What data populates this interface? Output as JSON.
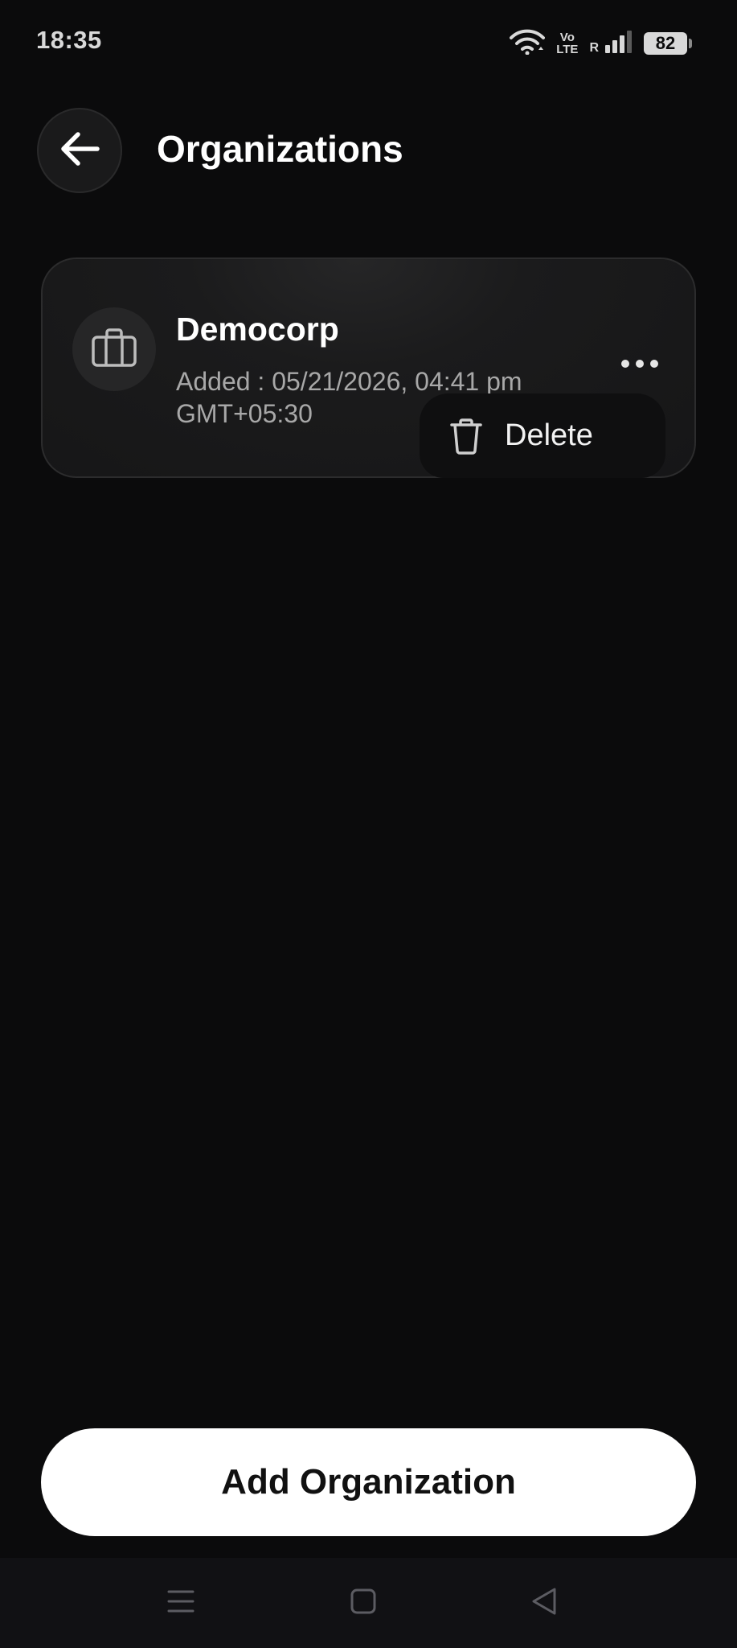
{
  "status_bar": {
    "time": "18:35",
    "volte_top": "Vo",
    "volte_bottom": "LTE",
    "roaming": "R",
    "battery": "82",
    "icons": [
      "wifi-icon",
      "volte-icon",
      "signal-icon",
      "battery-icon"
    ]
  },
  "header": {
    "title": "Organizations",
    "back_icon": "arrow-left-icon"
  },
  "organizations": [
    {
      "name": "Democorp",
      "added_line1": "Added : 05/21/2026, 04:41 pm",
      "added_line2": "GMT+05:30",
      "icon": "briefcase-icon"
    }
  ],
  "menu": {
    "delete_label": "Delete",
    "delete_icon": "trash-icon"
  },
  "footer": {
    "add_label": "Add Organization"
  },
  "nav": {
    "icons": [
      "menu-icon",
      "home-icon",
      "back-icon"
    ]
  },
  "colors": {
    "background": "#0b0b0c",
    "card": "#1b1b1c",
    "primary_button": "#ffffff",
    "secondary_text": "#a8a8a8"
  }
}
